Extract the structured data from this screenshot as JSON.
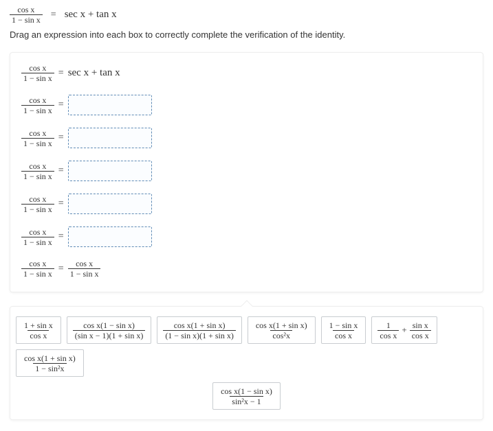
{
  "top_expr": {
    "lhs_num": "cos x",
    "lhs_den": "1 − sin x",
    "eq": "=",
    "rhs": "sec x + tan x"
  },
  "instruction": "Drag an expression into each box to correctly complete the verification of the identity.",
  "work": {
    "frac_num": "cos x",
    "frac_den": "1 − sin x",
    "eq": "=",
    "rhs_main": "sec x + tan x",
    "final_num": "cos x",
    "final_den": "1 − sin x"
  },
  "tiles": {
    "t1_num": "1 + sin x",
    "t1_den": "cos x",
    "t2_num": "cos x(1 − sin x)",
    "t2_den": "(sin x − 1)(1 + sin x)",
    "t3_num": "cos x(1 + sin x)",
    "t3_den": "(1 − sin x)(1 + sin x)",
    "t4_num": "cos x(1 + sin x)",
    "t4_den": "cos²x",
    "t5_num": "1 − sin x",
    "t5_den": "cos x",
    "t6a_num": "1",
    "t6a_den": "cos x",
    "t6_plus": "+",
    "t6b_num": "sin x",
    "t6b_den": "cos x",
    "t7_num": "cos x(1 + sin x)",
    "t7_den": "1 − sin²x",
    "t8_num": "cos x(1 − sin x)",
    "t8_den": "sin²x − 1"
  }
}
